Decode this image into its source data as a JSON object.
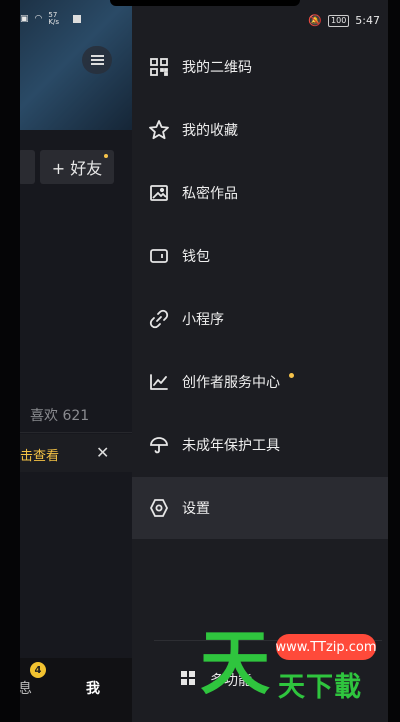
{
  "status": {
    "left_speed": "57\nK/s",
    "battery": "100",
    "time": "5:47"
  },
  "underlay": {
    "friend_button": "+ 好友",
    "likes": "喜欢 621",
    "notice_text": "击查看",
    "notice_close": "✕",
    "tab_message": "息",
    "tab_message_badge": "4",
    "tab_me": "我"
  },
  "drawer": {
    "items": [
      {
        "label": "我的二维码",
        "icon": "qr-code-icon"
      },
      {
        "label": "我的收藏",
        "icon": "star-icon"
      },
      {
        "label": "私密作品",
        "icon": "image-icon"
      },
      {
        "label": "钱包",
        "icon": "wallet-icon"
      },
      {
        "label": "小程序",
        "icon": "link-icon"
      },
      {
        "label": "创作者服务中心",
        "icon": "chart-icon"
      },
      {
        "label": "未成年保护工具",
        "icon": "umbrella-icon"
      },
      {
        "label": "设置",
        "icon": "settings-icon"
      }
    ],
    "more_label": "多功能"
  },
  "watermark": {
    "big_char": "天",
    "url": "www.TTzip.com",
    "small_text": "天下載"
  },
  "colors": {
    "drawer_bg": "#1c1d22",
    "active_row": "#2a2b31",
    "accent_yellow": "#f6c34a",
    "watermark_green": "#2fc53e",
    "watermark_red": "#ff4a3a"
  }
}
